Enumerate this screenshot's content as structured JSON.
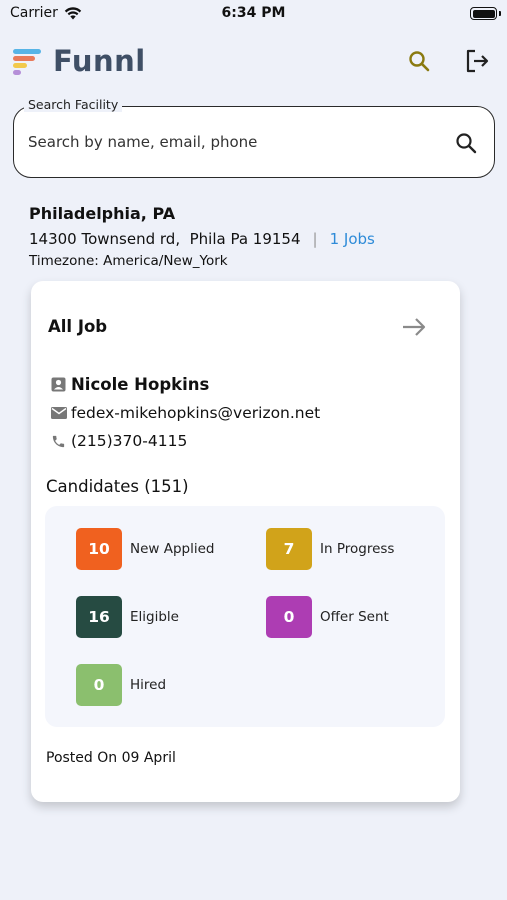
{
  "status_bar": {
    "carrier": "Carrier",
    "time": "6:34 PM"
  },
  "header": {
    "app_name": "Funnl",
    "logo_colors": [
      "#57b4e6",
      "#e87a5a",
      "#f2c94c",
      "#b58fd8"
    ],
    "icon_color": "#8a7a10",
    "search_icon": "search-icon",
    "logout_icon": "logout-icon"
  },
  "search": {
    "legend": "Search Facility",
    "placeholder": "Search by name, email, phone",
    "value": ""
  },
  "facility": {
    "name": "Philadelphia, PA",
    "address": "14300 Townsend rd,  Phila Pa 19154",
    "jobs_link": "1 Jobs",
    "timezone": "Timezone: America/New_York"
  },
  "card": {
    "title": "All Job",
    "contact_name": "Nicole Hopkins",
    "contact_email": "fedex-mikehopkins@verizon.net",
    "contact_phone": "(215)370-4115",
    "candidates_label": "Candidates (151)",
    "stats": [
      {
        "count": "10",
        "label": "New Applied",
        "color": "#f0611f"
      },
      {
        "count": "7",
        "label": "In Progress",
        "color": "#d1a31a"
      },
      {
        "count": "16",
        "label": "Eligible",
        "color": "#264b42"
      },
      {
        "count": "0",
        "label": "Offer Sent",
        "color": "#ad3db3"
      },
      {
        "count": "0",
        "label": "Hired",
        "color": "#8bbf6e"
      }
    ],
    "posted": "Posted On 09 April"
  }
}
